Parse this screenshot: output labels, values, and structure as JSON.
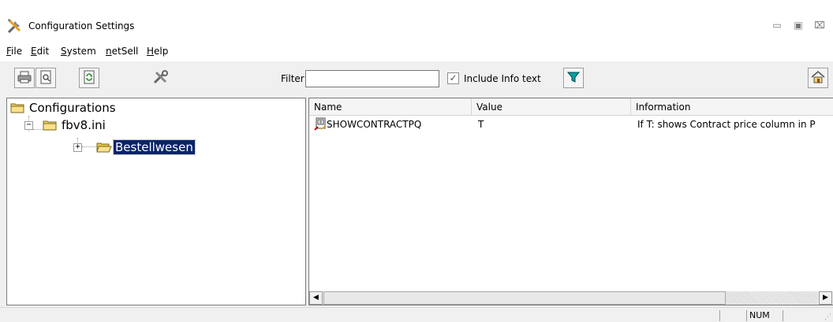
{
  "window": {
    "title": "Configuration Settings",
    "app_icon": "tools-icon",
    "controls": {
      "minimize": "▭",
      "maximize": "▣",
      "close": "⌧"
    }
  },
  "menu": [
    {
      "mnemonic": "F",
      "rest": "ile"
    },
    {
      "mnemonic": "E",
      "rest": "dit"
    },
    {
      "mnemonic": "S",
      "rest": "ystem"
    },
    {
      "mnemonic": "n",
      "rest": "etSell"
    },
    {
      "mnemonic": "H",
      "rest": "elp"
    }
  ],
  "toolbar": {
    "buttons": [
      "printer-icon",
      "print-preview-icon",
      "refresh-icon",
      "tools-icon"
    ],
    "filter_label": "Filter",
    "filter_value": "",
    "include_info_checked": true,
    "include_info_label": "Include Info text",
    "filter_button_icon": "funnel-icon",
    "home_button_icon": "home-icon"
  },
  "tree": {
    "root": {
      "label": "Configurations",
      "icon": "folder-icon"
    },
    "child": {
      "label": "fbv8.ini",
      "icon": "folder-icon",
      "expander": "−"
    },
    "grandchild": {
      "label": "Bestellwesen",
      "icon": "folder-open-icon",
      "expander": "+",
      "selected": true
    }
  },
  "list": {
    "columns": [
      "Name",
      "Value",
      "Information"
    ],
    "rows": [
      {
        "icon": "config-entry-icon",
        "name": "SHOWCONTRACTPQ",
        "value": "T",
        "info": "If T: shows Contract price column in P"
      }
    ]
  },
  "status": {
    "num": "NUM"
  },
  "colors": {
    "selection": "#0a246a",
    "accent_teal": "#008080"
  }
}
